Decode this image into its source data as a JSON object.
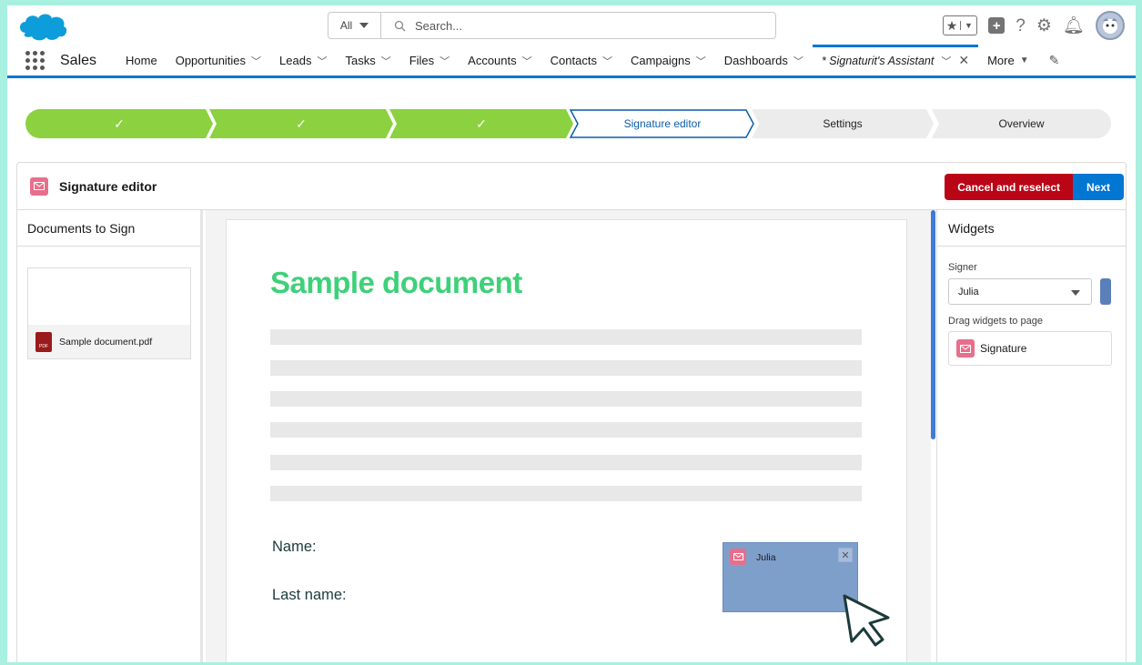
{
  "topbar": {
    "search_scope": "All",
    "search_placeholder": "Search..."
  },
  "nav": {
    "app_name": "Sales",
    "items": [
      {
        "label": "Home"
      },
      {
        "label": "Opportunities"
      },
      {
        "label": "Leads"
      },
      {
        "label": "Tasks"
      },
      {
        "label": "Files"
      },
      {
        "label": "Accounts"
      },
      {
        "label": "Contacts"
      },
      {
        "label": "Campaigns"
      },
      {
        "label": "Dashboards"
      }
    ],
    "active_tab": "* Signaturit's Assistant",
    "more_label": "More"
  },
  "path": {
    "steps": [
      {
        "label": "✓",
        "status": "complete"
      },
      {
        "label": "✓",
        "status": "complete"
      },
      {
        "label": "✓",
        "status": "complete"
      },
      {
        "label": "Signature editor",
        "status": "current"
      },
      {
        "label": "Settings",
        "status": "incomplete"
      },
      {
        "label": "Overview",
        "status": "incomplete"
      }
    ],
    "colors": {
      "complete": "#8bd140",
      "current_border": "#0b5cab",
      "incomplete": "#ececec"
    }
  },
  "card": {
    "title": "Signature editor",
    "cancel_label": "Cancel and reselect",
    "next_label": "Next"
  },
  "documents": {
    "title": "Documents to Sign",
    "items": [
      {
        "name": "Sample document.pdf",
        "type": "PDF"
      }
    ]
  },
  "page": {
    "title": "Sample document",
    "name_label": "Name:",
    "last_name_label": "Last name:",
    "placed_widget_signer": "Julia"
  },
  "widgets": {
    "title": "Widgets",
    "signer_label": "Signer",
    "signer_value": "Julia",
    "drag_label": "Drag widgets to page",
    "items": [
      {
        "label": "Signature",
        "icon": "envelope-icon"
      }
    ]
  },
  "colors": {
    "brand_blue": "#0176d3",
    "destructive": "#ba0517",
    "doc_title_green": "#3fd07a",
    "widget_pink": "#e86f8b",
    "placed_widget": "#7f9fcb"
  }
}
